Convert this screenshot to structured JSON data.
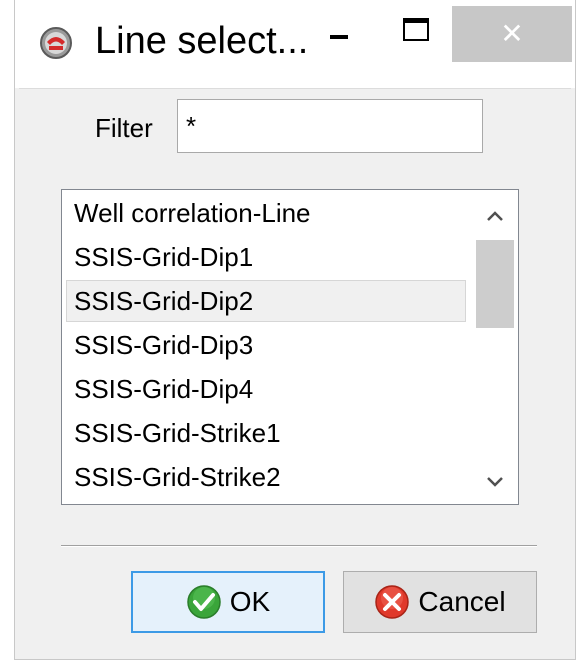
{
  "window": {
    "title": "Line select...",
    "icon": "app-logo-icon",
    "controls": {
      "minimize_icon": "minimize-icon",
      "maximize_icon": "maximize-icon",
      "close_icon": "close-icon",
      "close_glyph": "✕"
    }
  },
  "filter": {
    "label": "Filter",
    "value": "*"
  },
  "list": {
    "items": [
      {
        "label": "Well correlation-Line",
        "selected": false
      },
      {
        "label": "SSIS-Grid-Dip1",
        "selected": false
      },
      {
        "label": "SSIS-Grid-Dip2",
        "selected": true
      },
      {
        "label": "SSIS-Grid-Dip3",
        "selected": false
      },
      {
        "label": "SSIS-Grid-Dip4",
        "selected": false
      },
      {
        "label": "SSIS-Grid-Strike1",
        "selected": false
      },
      {
        "label": "SSIS-Grid-Strike2",
        "selected": false
      }
    ],
    "scroll_up_icon": "chevron-up-icon",
    "scroll_down_icon": "chevron-down-icon"
  },
  "buttons": {
    "ok_label": "OK",
    "ok_icon": "check-circle-icon",
    "cancel_label": "Cancel",
    "cancel_icon": "x-circle-icon"
  },
  "colors": {
    "ok_icon": "#3aa53a",
    "cancel_icon": "#e0392b",
    "focus_border": "#3c9ae6",
    "close_button": "#c7c7c7"
  }
}
